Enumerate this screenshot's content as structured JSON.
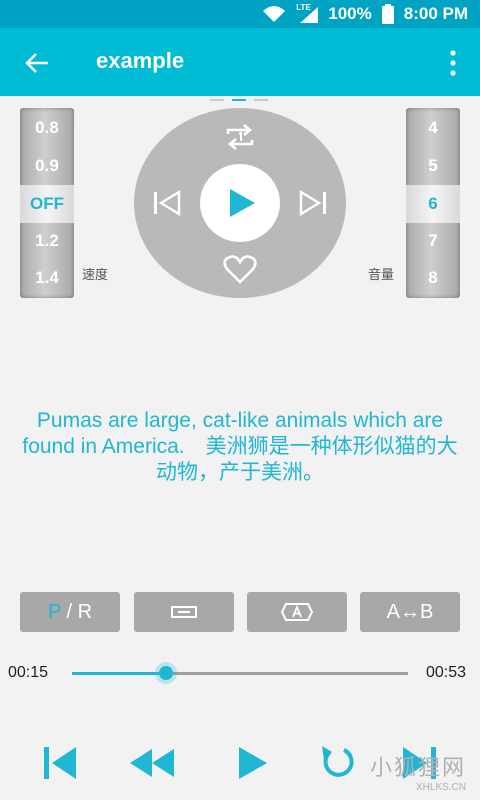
{
  "status_bar": {
    "battery": "100%",
    "time": "8:00 PM",
    "network": "LTE"
  },
  "app_bar": {
    "title": "example"
  },
  "speed_wheel": {
    "options": [
      "0.8",
      "0.9",
      "OFF",
      "1.2",
      "1.4"
    ],
    "selected": "OFF",
    "label": "速度"
  },
  "volume_wheel": {
    "options": [
      "4",
      "5",
      "6",
      "7",
      "8"
    ],
    "selected": "6",
    "label": "音量"
  },
  "lyrics": {
    "text": "Pumas are large, cat-like animals which are found in America.　美洲狮是一种体形似猫的大动物，产于美洲。"
  },
  "mode_buttons": {
    "pr_p": "P",
    "pr_sep": " / ",
    "pr_r": "R",
    "ab": "A↔B"
  },
  "player": {
    "current_time": "00:15",
    "total_time": "00:53",
    "progress": 0.28
  },
  "colors": {
    "accent": "#1fb7d4",
    "app_bar": "#00bcd4",
    "status_bar": "#00a3c4"
  },
  "watermark": {
    "text": "小狐狸网",
    "domain": "XHLKS.CN"
  }
}
